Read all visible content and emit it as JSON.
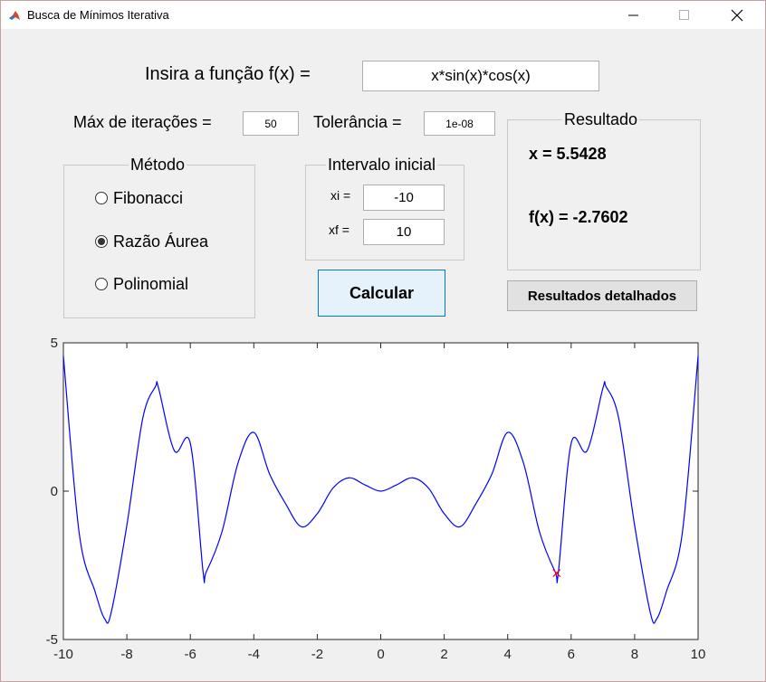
{
  "window": {
    "title": "Busca de Mínimos Iterativa",
    "minimize_glyph": "—",
    "maximize_glyph": "☐",
    "close_glyph": "✕"
  },
  "function_input": {
    "label": "Insira a função f(x) =",
    "value": "x*sin(x)*cos(x)"
  },
  "params": {
    "max_iter_label": "Máx de iterações =",
    "max_iter_value": "50",
    "tolerance_label": "Tolerância =",
    "tolerance_value": "1e-08"
  },
  "result_panel": {
    "title": "Resultado",
    "x_text": "x = 5.5428",
    "fx_text": "f(x) = -2.7602"
  },
  "method_panel": {
    "title": "Método",
    "options": [
      {
        "label": "Fibonacci",
        "selected": false
      },
      {
        "label": "Razão Áurea",
        "selected": true
      },
      {
        "label": "Polinomial",
        "selected": false
      }
    ]
  },
  "interval_panel": {
    "title": "Intervalo inicial",
    "xi_label": "xi =",
    "xi_value": "-10",
    "xf_label": "xf =",
    "xf_value": "10"
  },
  "buttons": {
    "calculate": "Calcular",
    "detailed_results": "Resultados detalhados"
  },
  "chart_data": {
    "type": "line",
    "function": "x*sin(x)*cos(x)",
    "xlim": [
      -10,
      10
    ],
    "ylim": [
      -5,
      5
    ],
    "xticks": [
      "-10",
      "-8",
      "-6",
      "-4",
      "-2",
      "0",
      "2",
      "4",
      "6",
      "8",
      "10"
    ],
    "yticks": [
      "-5",
      "0",
      "5"
    ],
    "series": [
      {
        "color": "#0000ff",
        "x": [
          -10,
          -9.5,
          -9,
          -8.7,
          -8.5,
          -8,
          -7.5,
          -7.1,
          -7,
          -6.5,
          -6,
          -5.6,
          -5.5,
          -5,
          -4.5,
          -4,
          -3.5,
          -3,
          -2.5,
          -2,
          -1.5,
          -1,
          -0.5,
          0,
          0.5,
          1,
          1.5,
          2,
          2.5,
          3,
          3.5,
          4,
          4.5,
          5,
          5.5,
          5.6,
          6,
          6.5,
          7,
          7.1,
          7.5,
          8,
          8.5,
          8.7,
          9,
          9.5,
          10
        ],
        "y": [
          4.56,
          -1.43,
          -3.39,
          -4.3,
          -4.12,
          -1.15,
          2.45,
          3.52,
          3.47,
          1.36,
          1.61,
          -2.7,
          -2.73,
          -1.36,
          0.94,
          1.98,
          0.57,
          -0.42,
          -1.2,
          -0.76,
          0.11,
          0.45,
          0.21,
          0,
          0.21,
          0.45,
          0.11,
          -0.76,
          -1.2,
          -0.42,
          0.57,
          1.98,
          0.94,
          -1.36,
          -2.73,
          -2.7,
          1.61,
          1.36,
          3.47,
          3.52,
          2.45,
          -1.15,
          -4.12,
          -4.3,
          -3.39,
          -1.43,
          4.56
        ]
      }
    ],
    "marker": {
      "x": 5.5428,
      "y": -2.7602,
      "symbol": "x",
      "color": "#ff0000"
    }
  }
}
